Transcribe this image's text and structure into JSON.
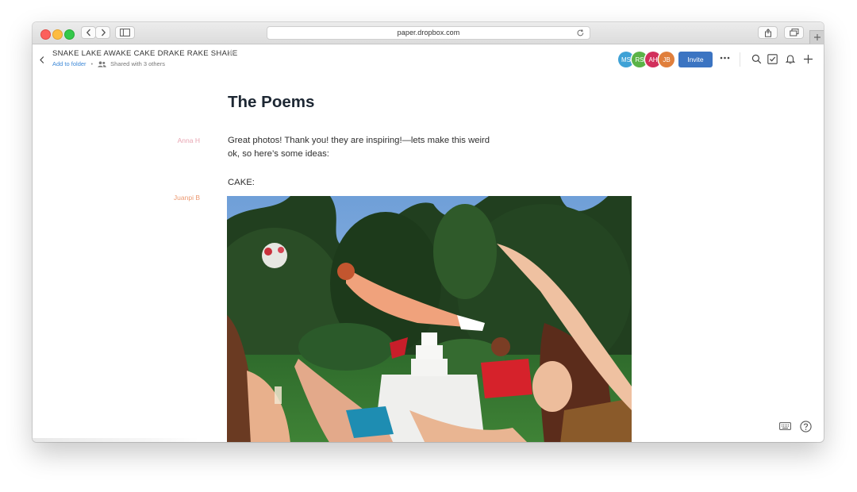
{
  "browser": {
    "url": "paper.dropbox.com",
    "icons": [
      "back-nav-icon",
      "forward-nav-icon",
      "sidebar-icon",
      "reload-icon",
      "share-icon",
      "tabs-icon",
      "new-tab-icon"
    ]
  },
  "document": {
    "title": "SNAKE LAKE AWAKE CAKE DRAKE RAKE SHAKE",
    "add_to_folder": "Add to folder",
    "separator": "•",
    "shared_with": "Shared with 3 others",
    "heading": "The Poems",
    "paragraph_1_line_1": "Great photos! Thank you! they are inspiring!—lets make this weird",
    "paragraph_1_line_2": "ok, so here’s some ideas:",
    "paragraph_2": "CAKE:"
  },
  "collaborators": [
    {
      "initials": "MS",
      "color": "#3fa2d6"
    },
    {
      "initials": "RS",
      "color": "#5bb348"
    },
    {
      "initials": "AH",
      "color": "#d2305c"
    },
    {
      "initials": "JB",
      "color": "#e07f3c"
    }
  ],
  "authors": [
    {
      "name": "Anna H",
      "color": "#e8a5b2"
    },
    {
      "name": "Juanpi B",
      "color": "#ec9a72"
    }
  ],
  "toolbar": {
    "invite_label": "Invite",
    "icons": [
      "more-icon",
      "search-icon",
      "checklist-icon",
      "bell-icon",
      "plus-icon"
    ]
  },
  "footer": {
    "icons": [
      "keyboard-icon",
      "help-icon"
    ]
  },
  "colors": {
    "accent": "#3b74c2",
    "link": "#3d88d7",
    "heading": "#1d2733"
  }
}
